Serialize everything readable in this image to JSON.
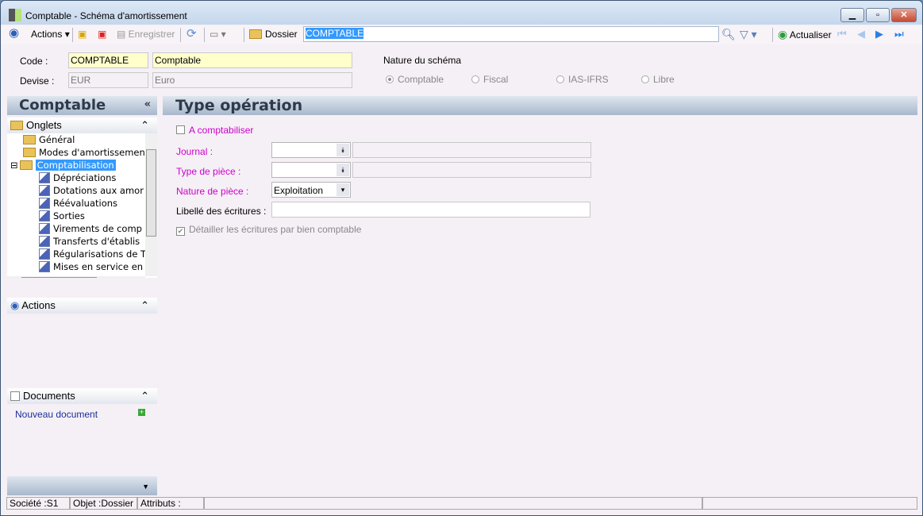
{
  "window": {
    "title": "Comptable -  Schéma d'amortissement"
  },
  "toolbar": {
    "actions": "Actions",
    "save": "Enregistrer",
    "folder": "Dossier",
    "search_value": "COMPTABLE",
    "refresh": "Actualiser"
  },
  "header": {
    "code_label": "Code :",
    "code_value": "COMPTABLE",
    "code_desc": "Comptable",
    "devise_label": "Devise :",
    "devise_value": "EUR",
    "devise_desc": "Euro",
    "nature_label": "Nature du schéma",
    "nature_options": [
      "Comptable",
      "Fiscal",
      "IAS-IFRS",
      "Libre"
    ],
    "nature_selected": "Comptable"
  },
  "sidebar": {
    "title": "Comptable",
    "onglets": "Onglets",
    "tree": [
      "Général",
      "Modes d'amortissemen",
      "Comptabilisation",
      "Dépréciations",
      "Dotations aux amor",
      "Réévaluations",
      "Sorties",
      "Virements de comp",
      "Transferts d'établis",
      "Régularisations de T",
      "Mises en service en"
    ],
    "actions": "Actions",
    "documents": "Documents",
    "new_document": "Nouveau document"
  },
  "main": {
    "title": "Type opération",
    "a_comptabiliser": "A comptabiliser",
    "journal_label": "Journal :",
    "type_piece_label": "Type de pièce :",
    "nature_piece_label": "Nature de pièce :",
    "nature_piece_value": "Exploitation",
    "libelle_label": "Libellé des écritures :",
    "detail_label": "Détailler les écritures par bien comptable"
  },
  "statusbar": {
    "societe": "Société :S1",
    "objet": "Objet :Dossier",
    "attributs": "Attributs :"
  }
}
